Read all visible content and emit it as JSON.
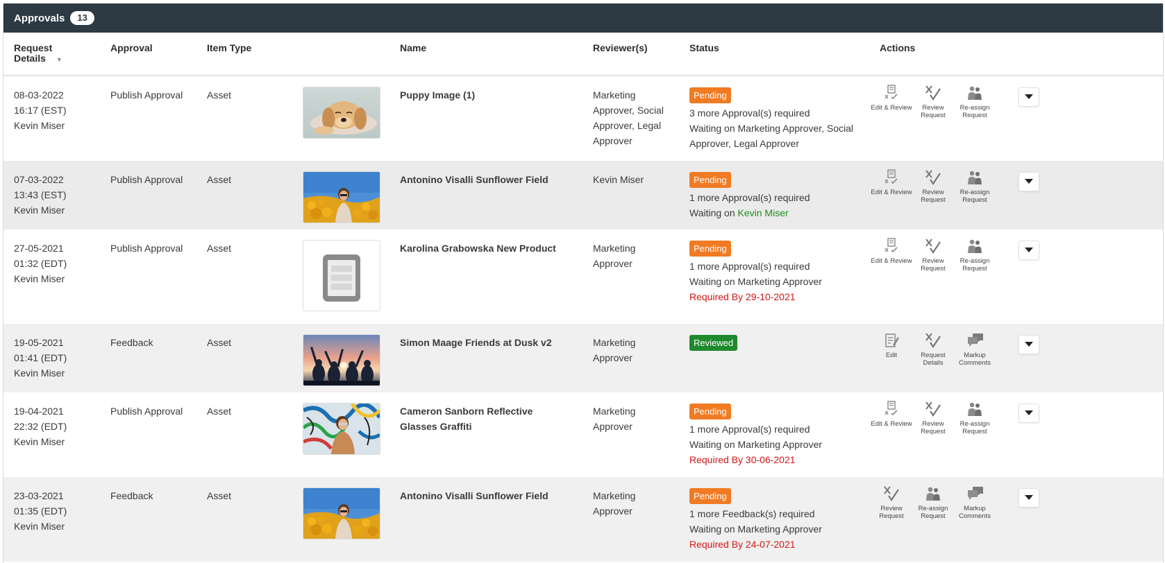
{
  "header": {
    "title": "Approvals",
    "count": "13"
  },
  "columns": {
    "request_details": "Request Details",
    "approval": "Approval",
    "item_type": "Item Type",
    "name": "Name",
    "reviewers": "Reviewer(s)",
    "status": "Status",
    "actions": "Actions"
  },
  "rows": [
    {
      "date": "08-03-2022",
      "time": "16:17 (EST)",
      "requester": "Kevin Miser",
      "approval": "Publish Approval",
      "item_type": "Asset",
      "name": "Puppy Image (1)",
      "reviewers": "Marketing Approver, Social Approver, Legal Approver",
      "status": "Pending",
      "line1": "3 more Approval(s) required",
      "line2": "Waiting on Marketing Approver, Social Approver, Legal Approver",
      "actions": [
        "Edit & Review",
        "Review Request",
        "Re-assign Request"
      ]
    },
    {
      "date": "07-03-2022",
      "time": "13:43 (EST)",
      "requester": "Kevin Miser",
      "approval": "Publish Approval",
      "item_type": "Asset",
      "name": "Antonino Visalli Sunflower Field",
      "reviewers": "Kevin Miser",
      "status": "Pending",
      "line1": "1 more Approval(s) required",
      "line2_prefix": "Waiting on ",
      "line2_name": "Kevin Miser",
      "actions": [
        "Edit & Review",
        "Review Request",
        "Re-assign Request"
      ]
    },
    {
      "date": "27-05-2021",
      "time": "01:32 (EDT)",
      "requester": "Kevin Miser",
      "approval": "Publish Approval",
      "item_type": "Asset",
      "name": "Karolina Grabowska New Product",
      "reviewers": "Marketing Approver",
      "status": "Pending",
      "line1": "1 more Approval(s) required",
      "line2": "Waiting on Marketing Approver",
      "required_by": "Required By 29-10-2021",
      "actions": [
        "Edit & Review",
        "Review Request",
        "Re-assign Request"
      ]
    },
    {
      "date": "19-05-2021",
      "time": "01:41 (EDT)",
      "requester": "Kevin Miser",
      "approval": "Feedback",
      "item_type": "Asset",
      "name": "Simon Maage Friends at Dusk v2",
      "reviewers": "Marketing Approver",
      "status": "Reviewed",
      "actions": [
        "Edit",
        "Request Details",
        "Markup Comments"
      ]
    },
    {
      "date": "19-04-2021",
      "time": "22:32 (EDT)",
      "requester": "Kevin Miser",
      "approval": "Publish Approval",
      "item_type": "Asset",
      "name": "Cameron Sanborn Reflective Glasses Graffiti",
      "reviewers": "Marketing Approver",
      "status": "Pending",
      "line1": "1 more Approval(s) required",
      "line2": "Waiting on Marketing Approver",
      "required_by": "Required By 30-06-2021",
      "actions": [
        "Edit & Review",
        "Review Request",
        "Re-assign Request"
      ]
    },
    {
      "date": "23-03-2021",
      "time": "01:35 (EDT)",
      "requester": "Kevin Miser",
      "approval": "Feedback",
      "item_type": "Asset",
      "name": "Antonino Visalli Sunflower Field",
      "reviewers": "Marketing Approver",
      "status": "Pending",
      "line1": "1 more Feedback(s) required",
      "line2": "Waiting on Marketing Approver",
      "required_by": "Required By 24-07-2021",
      "actions": [
        "Review Request",
        "Re-assign Request",
        "Markup Comments"
      ]
    }
  ],
  "colors": {
    "header_bg": "#2d3a44",
    "pending": "#f07b22",
    "reviewed": "#1f8a2d",
    "required_by": "#d31818",
    "user_link": "#208a1c"
  }
}
